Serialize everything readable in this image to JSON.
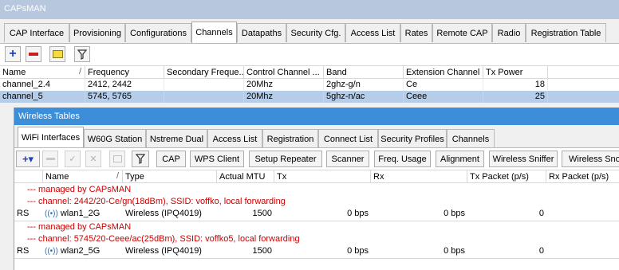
{
  "window": {
    "title": "CAPsMAN"
  },
  "tabs": [
    "CAP Interface",
    "Provisioning",
    "Configurations",
    "Channels",
    "Datapaths",
    "Security Cfg.",
    "Access List",
    "Rates",
    "Remote CAP",
    "Radio",
    "Registration Table"
  ],
  "active_tab": "Channels",
  "toolbar": {
    "add": "+",
    "remove": "−"
  },
  "channels_table": {
    "headers": [
      "Name",
      "Frequency",
      "Secondary Freque...",
      "Control Channel ...",
      "Band",
      "Extension Channel",
      "Tx Power"
    ],
    "rows": [
      {
        "name": "channel_2.4",
        "frequency": "2412, 2442",
        "secondary": "",
        "control_width": "20Mhz",
        "band": "2ghz-g/n",
        "extension": "Ce",
        "tx_power": "18"
      },
      {
        "name": "channel_5",
        "frequency": "5745, 5765",
        "secondary": "",
        "control_width": "20Mhz",
        "band": "5ghz-n/ac",
        "extension": "Ceee",
        "tx_power": "25"
      }
    ],
    "selected_row": "channel_5"
  },
  "wireless_tables": {
    "title": "Wireless Tables",
    "tabs": [
      "WiFi Interfaces",
      "W60G Station",
      "Nstreme Dual",
      "Access List",
      "Registration",
      "Connect List",
      "Security Profiles",
      "Channels"
    ],
    "active_tab": "WiFi Interfaces",
    "toolbar_buttons": {
      "add": "+▾",
      "cap": "CAP",
      "wps": "WPS Client",
      "setup_repeater": "Setup Repeater",
      "scanner": "Scanner",
      "freq_usage": "Freq. Usage",
      "alignment": "Alignment",
      "sniffer": "Wireless Sniffer",
      "snooper": "Wireless Snooper"
    },
    "headers": [
      "Name",
      "Type",
      "Actual MTU",
      "Tx",
      "Rx",
      "Tx Packet (p/s)",
      "Rx Packet (p/s)"
    ],
    "groups": [
      {
        "comment1": "--- managed by CAPsMAN",
        "comment2": "--- channel: 2442/20-Ce/gn(18dBm), SSID: voffko, local forwarding",
        "flags": "RS",
        "name": "wlan1_2G",
        "type": "Wireless (IPQ4019)",
        "mtu": "1500",
        "tx": "0 bps",
        "rx": "0 bps",
        "tx_pps": "0"
      },
      {
        "comment1": "--- managed by CAPsMAN",
        "comment2": "--- channel: 5745/20-Ceee/ac(25dBm), SSID: voffko5, local forwarding",
        "flags": "RS",
        "name": "wlan2_5G",
        "type": "Wireless (IPQ4019)",
        "mtu": "1500",
        "tx": "0 bps",
        "rx": "0 bps",
        "tx_pps": "0"
      }
    ]
  },
  "colors": {
    "title_inactive": "#b7c8de",
    "title_active": "#3c8ed9",
    "selection": "#b5cde8",
    "comment": "#cc0000",
    "add_icon": "#1f3fbf",
    "remove_icon": "#c81e1e"
  }
}
